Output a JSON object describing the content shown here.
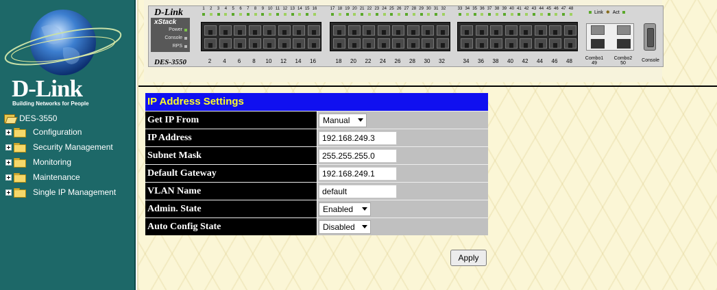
{
  "sidebar": {
    "brand": "D-Link",
    "tagline": "Building Networks for People",
    "root": "DES-3550",
    "items": [
      {
        "label": "Configuration"
      },
      {
        "label": "Security Management"
      },
      {
        "label": "Monitoring"
      },
      {
        "label": "Maintenance"
      },
      {
        "label": "Single IP Management"
      }
    ]
  },
  "device": {
    "brand": "D-Link",
    "stack_label": "xStack",
    "leds": [
      "Power",
      "Console",
      "RPS"
    ],
    "model": "DES-3550",
    "port_numbers_top": [
      "1",
      "2",
      "3",
      "4",
      "5",
      "6",
      "7",
      "8",
      "9",
      "10",
      "11",
      "12",
      "13",
      "14",
      "15",
      "16",
      "17",
      "18",
      "19",
      "20",
      "21",
      "22",
      "23",
      "24",
      "25",
      "26",
      "27",
      "28",
      "29",
      "30",
      "31",
      "32",
      "33",
      "34",
      "35",
      "36",
      "37",
      "38",
      "39",
      "40",
      "41",
      "42",
      "43",
      "44",
      "45",
      "46",
      "47",
      "48"
    ],
    "port_numbers_bottom": [
      "2",
      "4",
      "6",
      "8",
      "10",
      "12",
      "14",
      "16",
      "18",
      "20",
      "22",
      "24",
      "26",
      "28",
      "30",
      "32",
      "34",
      "36",
      "38",
      "40",
      "42",
      "44",
      "46",
      "48"
    ],
    "legend_link": "Link",
    "legend_act": "Act",
    "combo1": "Combo1",
    "combo1_num": "49",
    "combo2": "Combo2",
    "combo2_num": "50",
    "console": "Console"
  },
  "settings": {
    "title": "IP Address Settings",
    "rows": [
      {
        "label": "Get IP From",
        "value": "Manual",
        "type": "select"
      },
      {
        "label": "IP Address",
        "value": "192.168.249.3",
        "type": "input"
      },
      {
        "label": "Subnet Mask",
        "value": "255.255.255.0",
        "type": "input"
      },
      {
        "label": "Default Gateway",
        "value": "192.168.249.1",
        "type": "input"
      },
      {
        "label": "VLAN Name",
        "value": "default",
        "type": "input"
      },
      {
        "label": "Admin. State",
        "value": "Enabled",
        "type": "select"
      },
      {
        "label": "Auto Config State",
        "value": "Disabled",
        "type": "select"
      }
    ],
    "apply_label": "Apply"
  },
  "colors": {
    "sidebar_bg": "#1d6868",
    "title_bg": "#1010f0",
    "title_fg": "#ffff28",
    "label_bg": "#000000",
    "value_bg": "#c0c0c0"
  }
}
